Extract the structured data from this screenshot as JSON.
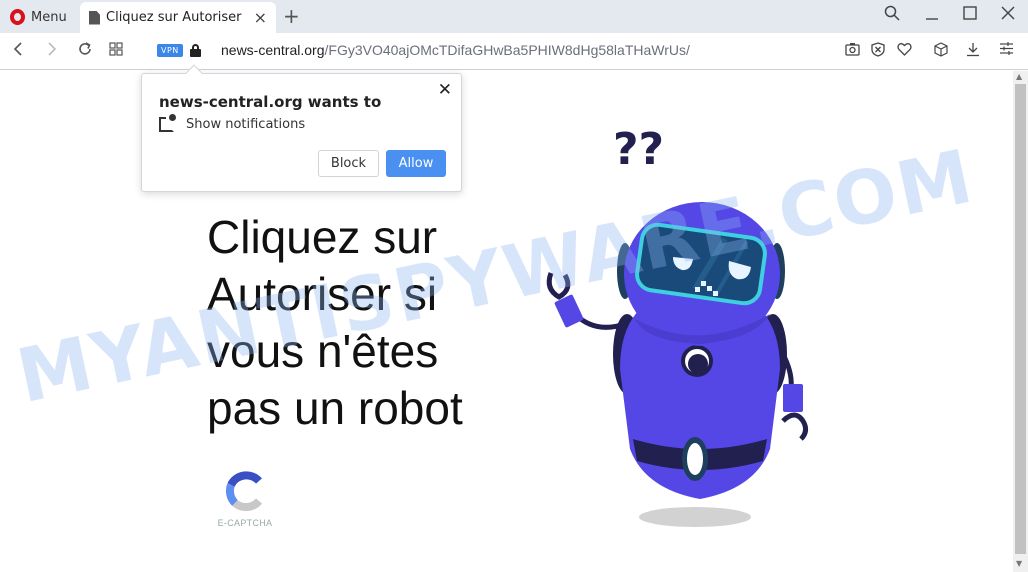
{
  "browser": {
    "menu_label": "Menu",
    "tab": {
      "title": "Cliquez sur Autoriser si vous n'êtes pas un robot",
      "close": "×"
    },
    "new_tab": "+",
    "window_controls": {
      "search": "search-icon",
      "minimize": "—",
      "maximize": "☐",
      "close": "✕"
    },
    "vpn_badge": "VPN",
    "url_domain": "news-central.org",
    "url_path": "/FGy3VO40ajOMcTDifaGHwBa5PHIW8dHg58laTHaWrUs/",
    "right_icons": [
      "camera-icon",
      "shield-block-icon",
      "heart-icon",
      "cube-icon",
      "download-icon",
      "settings-sliders-icon"
    ]
  },
  "permission_popup": {
    "title": "news-central.org wants to",
    "permission": "Show notifications",
    "close": "✕",
    "block_label": "Block",
    "allow_label": "Allow"
  },
  "page": {
    "headline_lines": [
      "Cliquez sur",
      "Autoriser si",
      "vous n'êtes",
      "pas un robot"
    ],
    "captcha_label": "E-CAPTCHA",
    "robot_symbol": "??",
    "watermark": "MYANTISPYWARE.COM"
  },
  "colors": {
    "allow_button": "#4a90f0",
    "vpn_badge": "#3a86e9",
    "robot_body": "#5447e6",
    "robot_dark": "#22204f",
    "visor_border": "#3ed0e0"
  }
}
